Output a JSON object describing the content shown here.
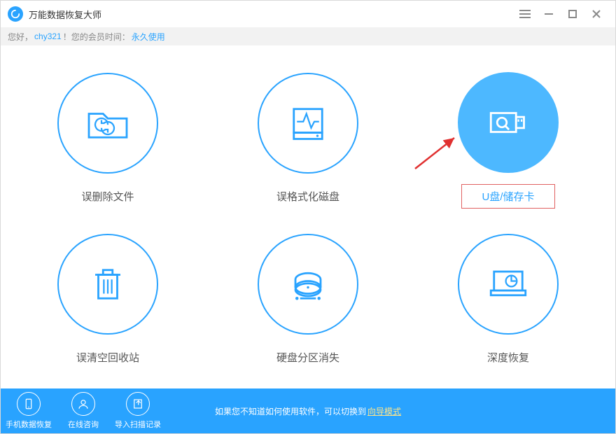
{
  "titlebar": {
    "title": "万能数据恢复大师"
  },
  "greeting": {
    "prefix": "您好，",
    "username": "chy321",
    "mid": "！您的会员时间：",
    "duration": "永久使用"
  },
  "options": [
    {
      "key": "deleted-files",
      "label": "误删除文件"
    },
    {
      "key": "formatted-disk",
      "label": "误格式化磁盘"
    },
    {
      "key": "usb-sdcard",
      "label": "U盘/储存卡",
      "highlighted": true
    },
    {
      "key": "recycle-bin",
      "label": "误清空回收站"
    },
    {
      "key": "partition-lost",
      "label": "硬盘分区消失"
    },
    {
      "key": "deep-recovery",
      "label": "深度恢复"
    }
  ],
  "footer": {
    "mobile": "手机数据恢复",
    "online": "在线咨询",
    "import": "导入扫描记录",
    "hint_prefix": "如果您不知道如何使用软件，可以切换到",
    "hint_link": "向导模式"
  }
}
